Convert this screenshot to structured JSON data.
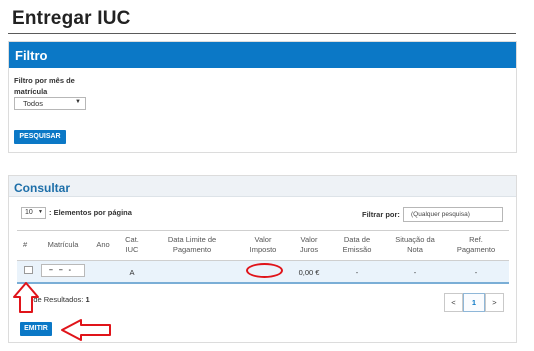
{
  "page": {
    "title": "Entregar IUC"
  },
  "filtro": {
    "heading": "Filtro",
    "month_label": "Filtro por mês de matrícula",
    "month_select_value": "Todos",
    "search_button": "PESQUISAR"
  },
  "consultar": {
    "heading": "Consultar",
    "per_page_value": "10",
    "per_page_label": ": Elementos por página",
    "filter_label": "Filtrar por:",
    "filter_placeholder": "(Qualquer pesquisa)",
    "columns": [
      "#",
      "Matrícula",
      "Ano",
      "Cat. IUC",
      "Data Limite de Pagamento",
      "Valor Imposto",
      "Valor Juros",
      "Data de Emissão",
      "Situação da Nota",
      "Ref. Pagamento"
    ],
    "row": {
      "matricula": "– – -",
      "ano": "",
      "cat": "A",
      "data_limite": "",
      "valor_imposto": "",
      "valor_juros": "0,00 €",
      "data_emissao": "-",
      "situacao": "-",
      "ref_pagamento": "-"
    },
    "results_label": "N.º de Resultados:",
    "results_count": "1",
    "pager": {
      "prev": "<",
      "current": "1",
      "next": ">"
    },
    "emit_button": "EMITIR"
  },
  "annotation_colors": {
    "red": "#e0141a"
  }
}
